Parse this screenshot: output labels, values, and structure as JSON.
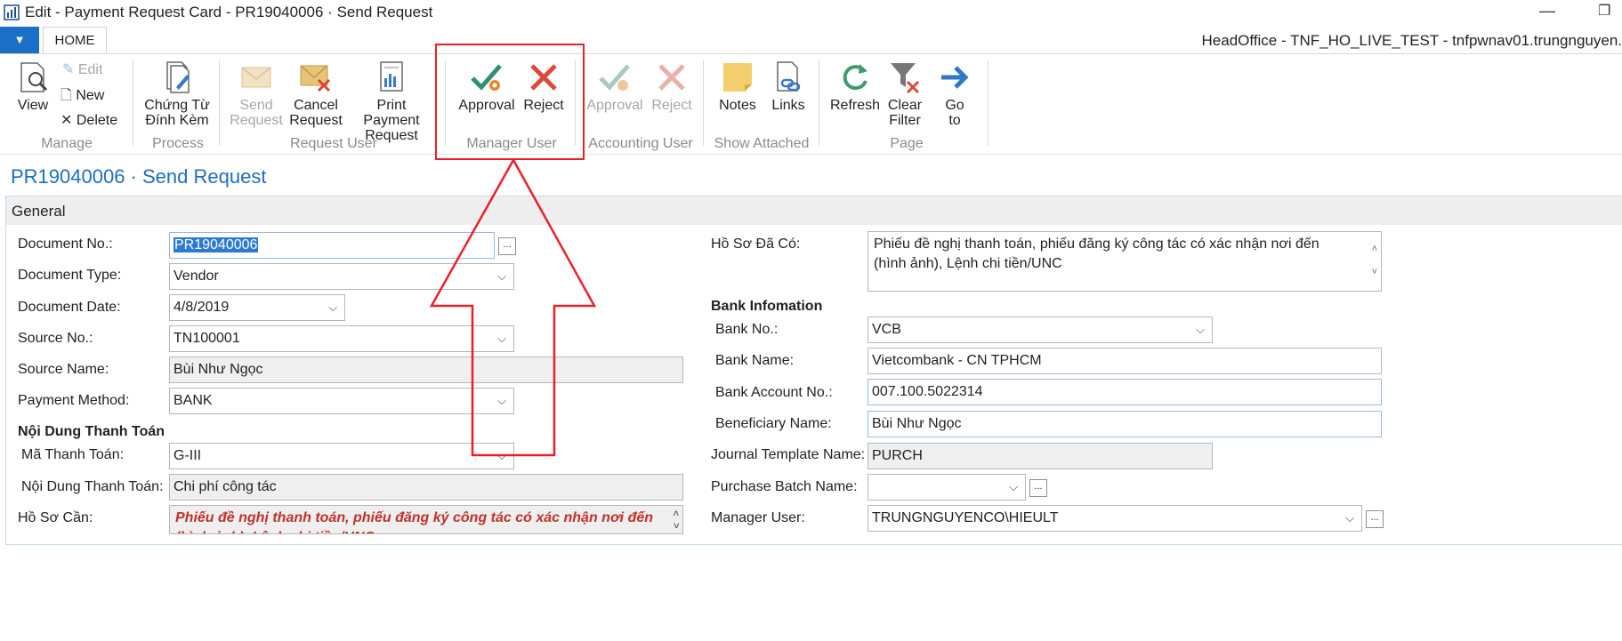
{
  "window": {
    "title": "Edit - Payment Request Card - PR19040006 · Send Request",
    "minimize": "—",
    "maximize": "❐"
  },
  "ribbon": {
    "file_menu_glyph": "▼",
    "home_tab": "HOME",
    "server_info": "HeadOffice - TNF_HO_LIVE_TEST - tnfpwnav01.trungnguyen.",
    "manage": {
      "view": "View",
      "edit": "Edit",
      "new": "New",
      "delete": "Delete",
      "group": "Manage"
    },
    "process": {
      "chung_tu_line1": "Chứng Từ",
      "chung_tu_line2": "Đính Kèm",
      "group": "Process"
    },
    "request_user": {
      "send_line1": "Send",
      "send_line2": "Request",
      "cancel_line1": "Cancel",
      "cancel_line2": "Request",
      "print_line1": "Print Payment",
      "print_line2": "Request",
      "group": "Request User"
    },
    "manager_user": {
      "approval": "Approval",
      "reject": "Reject",
      "group": "Manager User"
    },
    "accounting_user": {
      "approval": "Approval",
      "reject": "Reject",
      "group": "Accounting User"
    },
    "show_attached": {
      "notes": "Notes",
      "links": "Links",
      "group": "Show Attached"
    },
    "page": {
      "refresh": "Refresh",
      "clear_line1": "Clear",
      "clear_line2": "Filter",
      "goto_line1": "Go",
      "goto_line2": "to",
      "group": "Page"
    }
  },
  "colors": {
    "accent": "#1c6fc7",
    "highlight": "#e8202a",
    "title": "#1f6dbf"
  },
  "page": {
    "title": "PR19040006 · Send Request"
  },
  "general": {
    "title": "General",
    "document_no": {
      "label": "Document No.:",
      "value": "PR19040006"
    },
    "document_type": {
      "label": "Document Type:",
      "value": "Vendor"
    },
    "document_date": {
      "label": "Document Date:",
      "value": "4/8/2019"
    },
    "source_no": {
      "label": "Source No.:",
      "value": "TN100001"
    },
    "source_name": {
      "label": "Source Name:",
      "value": "Bùi Như Ngọc"
    },
    "payment_method": {
      "label": "Payment Method:",
      "value": "BANK"
    },
    "noi_dung_header": "Nội Dung Thanh Toán",
    "ma_thanh_toan": {
      "label": "Mã Thanh Toán:",
      "value": "G-III"
    },
    "noi_dung_thanh_toan": {
      "label": "Nội Dung Thanh Toán:",
      "value": "Chi phí công tác"
    },
    "ho_so_can": {
      "label": "Hồ Sơ Cần:",
      "value": "Phiếu đề nghị thanh toán, phiếu đăng ký công tác có xác nhận nơi đến (hình ảnh), Lệnh chi tiền/UNC"
    },
    "ho_so_da_co": {
      "label": "Hồ Sơ Đã Có:",
      "value": "Phiếu đề nghị thanh toán, phiếu đăng ký công tác có xác nhận nơi đến (hình ảnh), Lệnh chi tiền/UNC"
    },
    "bank_header": "Bank Infomation",
    "bank_no": {
      "label": "Bank No.:",
      "value": "VCB"
    },
    "bank_name": {
      "label": "Bank Name:",
      "value": "Vietcombank - CN TPHCM"
    },
    "bank_account_no": {
      "label": "Bank Account No.:",
      "value": "007.100.5022314"
    },
    "beneficiary_name": {
      "label": "Beneficiary Name:",
      "value": "Bùi Như Ngọc"
    },
    "journal_template_name": {
      "label": "Journal Template Name:",
      "value": "PURCH"
    },
    "purchase_batch_name": {
      "label": "Purchase Batch Name:",
      "value": ""
    },
    "manager_user": {
      "label": "Manager User:",
      "value": "TRUNGNGUYENCO\\HIEULT"
    },
    "lookup_glyph": "...",
    "dropdown_glyph": "⌵"
  }
}
